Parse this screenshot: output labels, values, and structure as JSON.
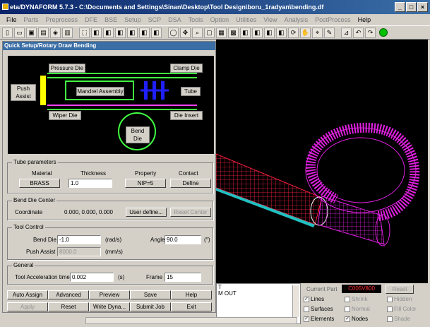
{
  "window": {
    "title": "eta/DYNAFORM 5.7.3 - C:\\Documents and Settings\\Sinan\\Desktop\\Tool Design\\boru_1radyan\\bending.df",
    "min_label": "_",
    "max_label": "□",
    "close_label": "×"
  },
  "menu": [
    {
      "label": "File",
      "enabled": true
    },
    {
      "label": "Parts",
      "enabled": false
    },
    {
      "label": "Preprocess",
      "enabled": false
    },
    {
      "label": "DFE",
      "enabled": false
    },
    {
      "label": "BSE",
      "enabled": false
    },
    {
      "label": "Setup",
      "enabled": false
    },
    {
      "label": "SCP",
      "enabled": false
    },
    {
      "label": "DSA",
      "enabled": false
    },
    {
      "label": "Tools",
      "enabled": false
    },
    {
      "label": "Option",
      "enabled": false
    },
    {
      "label": "Utilities",
      "enabled": false
    },
    {
      "label": "View",
      "enabled": false
    },
    {
      "label": "Analysis",
      "enabled": false
    },
    {
      "label": "PostProcess",
      "enabled": false
    },
    {
      "label": "Help",
      "enabled": true
    }
  ],
  "toolbar_icons": [
    "new-file",
    "open-folder",
    "save-disk",
    "print",
    "part-box",
    "preview",
    "model-box",
    "cube-1",
    "cube-2",
    "cube-3",
    "cube-4",
    "cube-5",
    "cube-6",
    "circle-select",
    "move-arrows",
    "zoom",
    "frame",
    "window-select",
    "display",
    "cube-7",
    "cube-8",
    "cube-9",
    "cube-10",
    "rotate-view",
    "pan-view",
    "measure",
    "pen",
    "ruler",
    "undo",
    "redo",
    "status-indicator"
  ],
  "panel": {
    "title": "Quick Setup/Rotary Draw Bending",
    "diagram": {
      "pressure_die": "Pressure Die",
      "clamp_die": "Clamp Die",
      "push_assist": "Push\nAssist",
      "mandrel": "Mandrel Assembly",
      "tube": "Tube",
      "wiper_die": "Wiper Die",
      "die_insert": "Die Insert",
      "bend_die": "Bend Die"
    },
    "tube_params": {
      "group_label": "Tube parameters",
      "material_label": "Material",
      "thickness_label": "Thickness",
      "property_label": "Property",
      "contact_label": "Contact",
      "material_value": "BRASS",
      "thickness_value": "1.0",
      "property_value": "NIP=5",
      "contact_value": "Define"
    },
    "bend_center": {
      "group_label": "Bend Die Center",
      "coord_label": "Coordinate",
      "coord_value": "0.000,  0.000,  0.000",
      "user_define": "User define...",
      "reset_center": "Reset Center"
    },
    "tool_control": {
      "group_label": "Tool Control",
      "bend_die_label": "Bend Die",
      "bend_die_value": "-1.0",
      "bend_die_unit": "(rad/s)",
      "angle_label": "Angle",
      "angle_value": "90.0",
      "angle_unit": "(°)",
      "push_assist_label": "Push Assist",
      "push_assist_value": "8000.0",
      "push_assist_unit": "(mm/s)"
    },
    "general": {
      "group_label": "General",
      "accel_label": "Tool Acceleration time",
      "accel_value": "0.002",
      "accel_unit": "(s)",
      "frame_label": "Frame",
      "frame_value": "15"
    },
    "buttons": {
      "auto_assign": "Auto Assign",
      "advanced": "Advanced",
      "preview": "Preview",
      "save": "Save",
      "help": "Help",
      "apply": "Apply",
      "reset": "Reset",
      "write_dyna": "Write Dyna...",
      "submit_job": "Submit Job",
      "exit": "Exit"
    }
  },
  "console": {
    "lines": [
      "T",
      "M OUT"
    ]
  },
  "lower_panel": {
    "current_part_label": "Current Part",
    "current_part_value": "C005V800",
    "reset_label": "Reset",
    "lines": "Lines",
    "shrink": "Shrink",
    "hidden": "Hidden",
    "surfaces": "Surfaces",
    "normal": "Normal",
    "fill_color": "Fill Color",
    "elements": "Elements",
    "nodes": "Nodes",
    "shade": "Shade"
  },
  "colors": {
    "accent": "#0a246a",
    "magenta_mesh": "#e020e0",
    "red_mesh": "#ff2040",
    "current_part": "#ff3030"
  }
}
